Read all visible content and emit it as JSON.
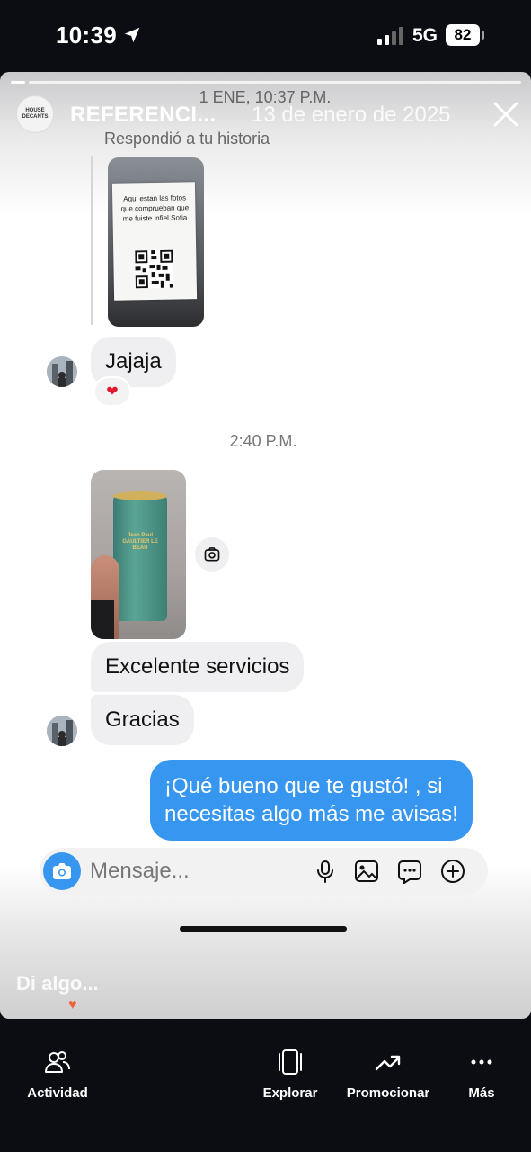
{
  "status_bar": {
    "time": "10:39",
    "network": "5G",
    "battery": "82"
  },
  "header": {
    "account_name": "REFERENCI...",
    "date": "13 de enero de 2025"
  },
  "chat": {
    "timestamp_1": "1 ENE, 10:37 P.M.",
    "replied_label": "Respondió a tu historia",
    "story_note": "Aqui estan las fotos que comprueban que me fuiste infiel Sofia",
    "msg_jajaja": "Jajaja",
    "reaction": "❤",
    "timestamp_2": "2:40 P.M.",
    "can_label": "Jean Paul GAULTIER LE BEAU",
    "msg_excelente": "Excelente servicios",
    "msg_gracias": "Gracias",
    "reply_line_1": "¡Qué bueno que te gustó! , si",
    "reply_line_2": "necesitas algo más me avisas!"
  },
  "composer": {
    "placeholder": "Mensaje..."
  },
  "story_footer": {
    "say_something": "Di algo..."
  },
  "bottom_nav": {
    "activity": "Actividad",
    "explore": "Explorar",
    "promote": "Promocionar",
    "more": "Más"
  },
  "logo_text": "HOUSE DECANTS",
  "colors": {
    "accent": "#3797f0",
    "background": "#0b0d12",
    "bubble_in": "#efeff1"
  }
}
